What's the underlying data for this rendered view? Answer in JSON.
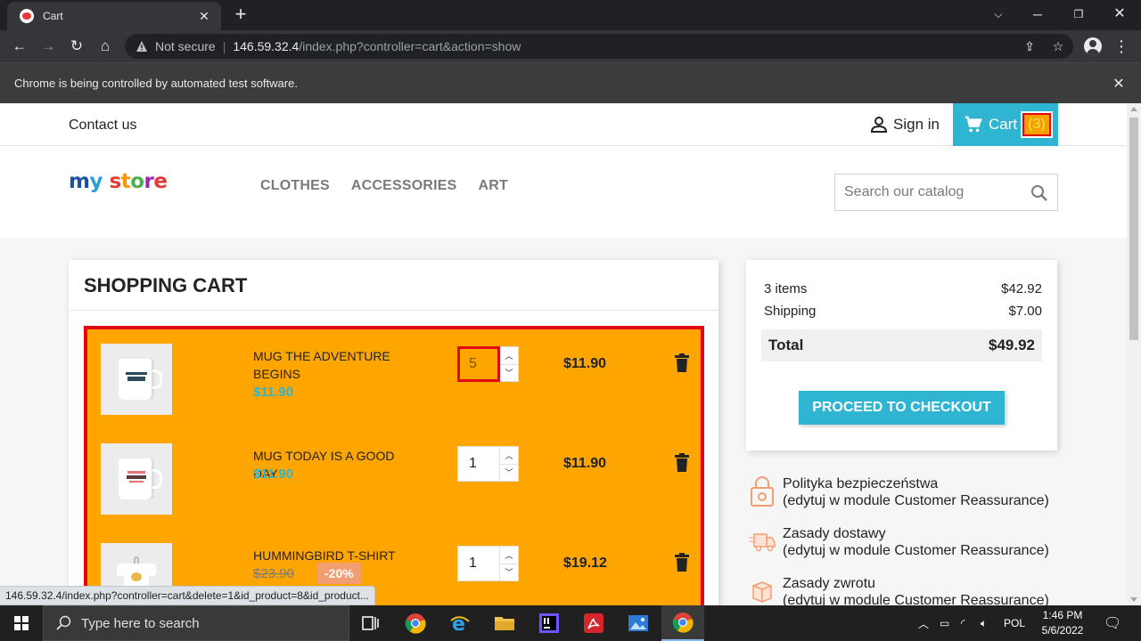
{
  "browser": {
    "tab_title": "Cart",
    "new_tab": "+",
    "security_label": "Not secure",
    "url_host": "146.59.32.4",
    "url_path": "/index.php?controller=cart&action=show",
    "infobar_text": "Chrome is being controlled by automated test software.",
    "status_url": "146.59.32.4/index.php?controller=cart&delete=1&id_product=8&id_product..."
  },
  "store": {
    "contact": "Contact us",
    "signin": "Sign in",
    "cart_label": "Cart",
    "cart_count": "(3)",
    "logo": [
      "m",
      "y",
      " ",
      "s",
      "t",
      "o",
      "r",
      "e"
    ],
    "menu": [
      "CLOTHES",
      "ACCESSORIES",
      "ART"
    ],
    "search_placeholder": "Search our catalog"
  },
  "cart": {
    "title": "SHOPPING CART",
    "items": [
      {
        "name": "MUG THE ADVENTURE BEGINS",
        "price": "$11.90",
        "quantity": "5",
        "total": "$11.90",
        "image": "mug-adventure"
      },
      {
        "name": "MUG TODAY IS A GOOD DAY",
        "price": "$11.90",
        "quantity": "1",
        "total": "$11.90",
        "image": "mug-today"
      },
      {
        "name": "HUMMINGBIRD T-SHIRT",
        "old_price": "$23.90",
        "discount": "-20%",
        "quantity": "1",
        "total": "$19.12",
        "image": "tshirt-hummingbird"
      }
    ]
  },
  "summary": {
    "items_label": "3 items",
    "items_value": "$42.92",
    "shipping_label": "Shipping",
    "shipping_value": "$7.00",
    "total_label": "Total",
    "total_value": "$49.92",
    "checkout": "PROCEED TO CHECKOUT"
  },
  "reassurance": [
    {
      "title": "Polityka bezpieczeństwa",
      "sub": "(edytuj w module Customer Reassurance)",
      "icon": "lock-icon"
    },
    {
      "title": "Zasady dostawy",
      "sub": "(edytuj w module Customer Reassurance)",
      "icon": "truck-icon"
    },
    {
      "title": "Zasady zwrotu",
      "sub": "(edytuj w module Customer Reassurance)",
      "icon": "return-icon"
    }
  ],
  "taskbar": {
    "search_placeholder": "Type here to search",
    "lang": "POL",
    "time": "1:46 PM",
    "date": "5/6/2022"
  },
  "colors": {
    "accent": "#2fb5d2",
    "highlight_bg": "#ffa500",
    "highlight_border": "#e30613"
  }
}
